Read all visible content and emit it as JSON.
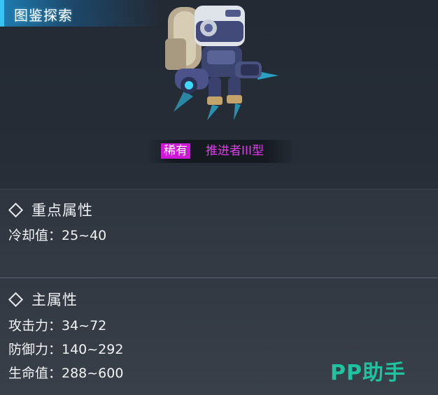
{
  "header": {
    "title": "图鉴探索"
  },
  "item": {
    "rarity": "稀有",
    "name": "推进者III型",
    "rarity_color": "#d019d8",
    "name_color": "#e13cf0",
    "image": "robot-thruster-mech"
  },
  "sections": [
    {
      "title": "重点属性",
      "icon": "diamond-icon",
      "stats": [
        {
          "text": "冷却值：25~40"
        }
      ]
    },
    {
      "title": "主属性",
      "icon": "diamond-icon",
      "stats": [
        {
          "text": "攻击力：34~72"
        },
        {
          "text": "防御力：140~292"
        },
        {
          "text": "生命值：288~600"
        }
      ]
    }
  ],
  "watermark": {
    "text": "PP助手",
    "color": "#1fc3a0"
  }
}
